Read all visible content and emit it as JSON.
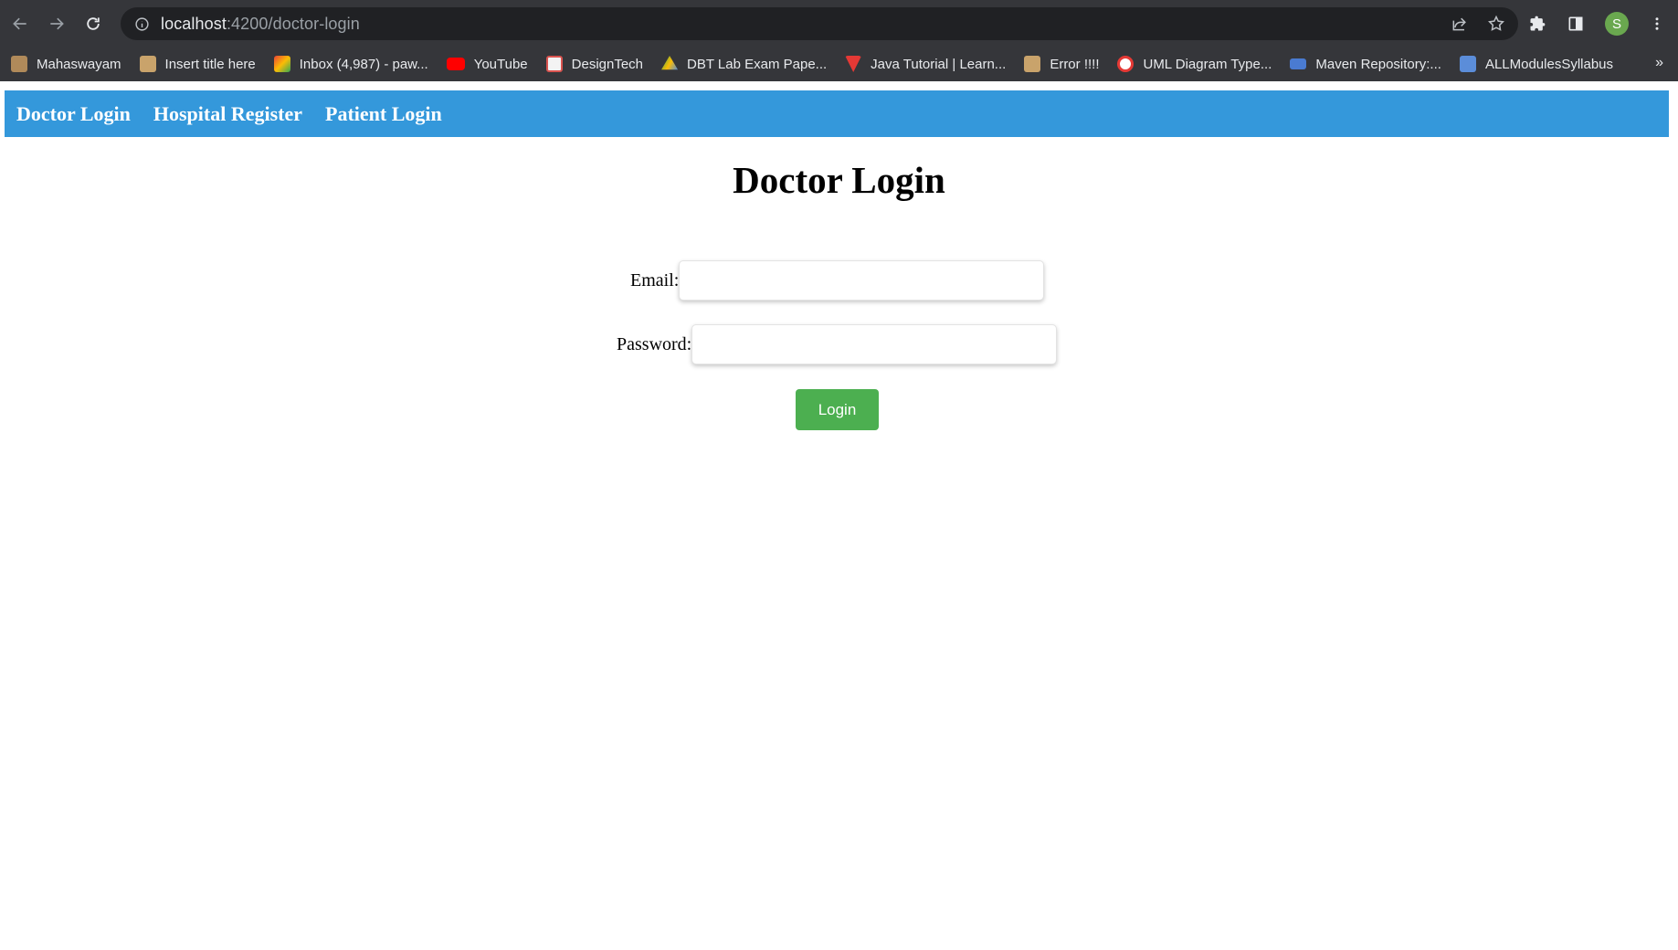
{
  "browser": {
    "url_host": "localhost",
    "url_path": ":4200/doctor-login",
    "profile_initial": "S",
    "bookmarks": [
      {
        "label": "Mahaswayam",
        "icon": "mahaswayam-icon",
        "color": "#b08a5a"
      },
      {
        "label": "Insert title here",
        "icon": "page-icon",
        "color": "#c9a36b"
      },
      {
        "label": "Inbox (4,987) - paw...",
        "icon": "gmail-icon",
        "color": "#ea4335"
      },
      {
        "label": "YouTube",
        "icon": "youtube-icon",
        "color": "#ff0000"
      },
      {
        "label": "DesignTech",
        "icon": "designtech-icon",
        "color": "#d9534f"
      },
      {
        "label": "DBT Lab Exam Pape...",
        "icon": "drive-icon",
        "color": "#34a853"
      },
      {
        "label": "Java Tutorial | Learn...",
        "icon": "javatpoint-icon",
        "color": "#e53935"
      },
      {
        "label": "Error !!!!",
        "icon": "page-icon",
        "color": "#c9a36b"
      },
      {
        "label": "UML Diagram Type...",
        "icon": "uml-icon",
        "color": "#e53935"
      },
      {
        "label": "Maven Repository:...",
        "icon": "maven-icon",
        "color": "#4a7bd1"
      },
      {
        "label": "ALLModulesSyllabus",
        "icon": "syllabus-icon",
        "color": "#5b8dd9"
      }
    ],
    "more_label": "»"
  },
  "navbar": {
    "links": [
      "Doctor Login",
      "Hospital Register",
      "Patient Login"
    ],
    "color": "#3498db"
  },
  "page": {
    "title": "Doctor Login",
    "email_label": "Email:",
    "email_value": "",
    "password_label": "Password:",
    "password_value": "",
    "login_label": "Login",
    "login_color": "#4caf50"
  }
}
